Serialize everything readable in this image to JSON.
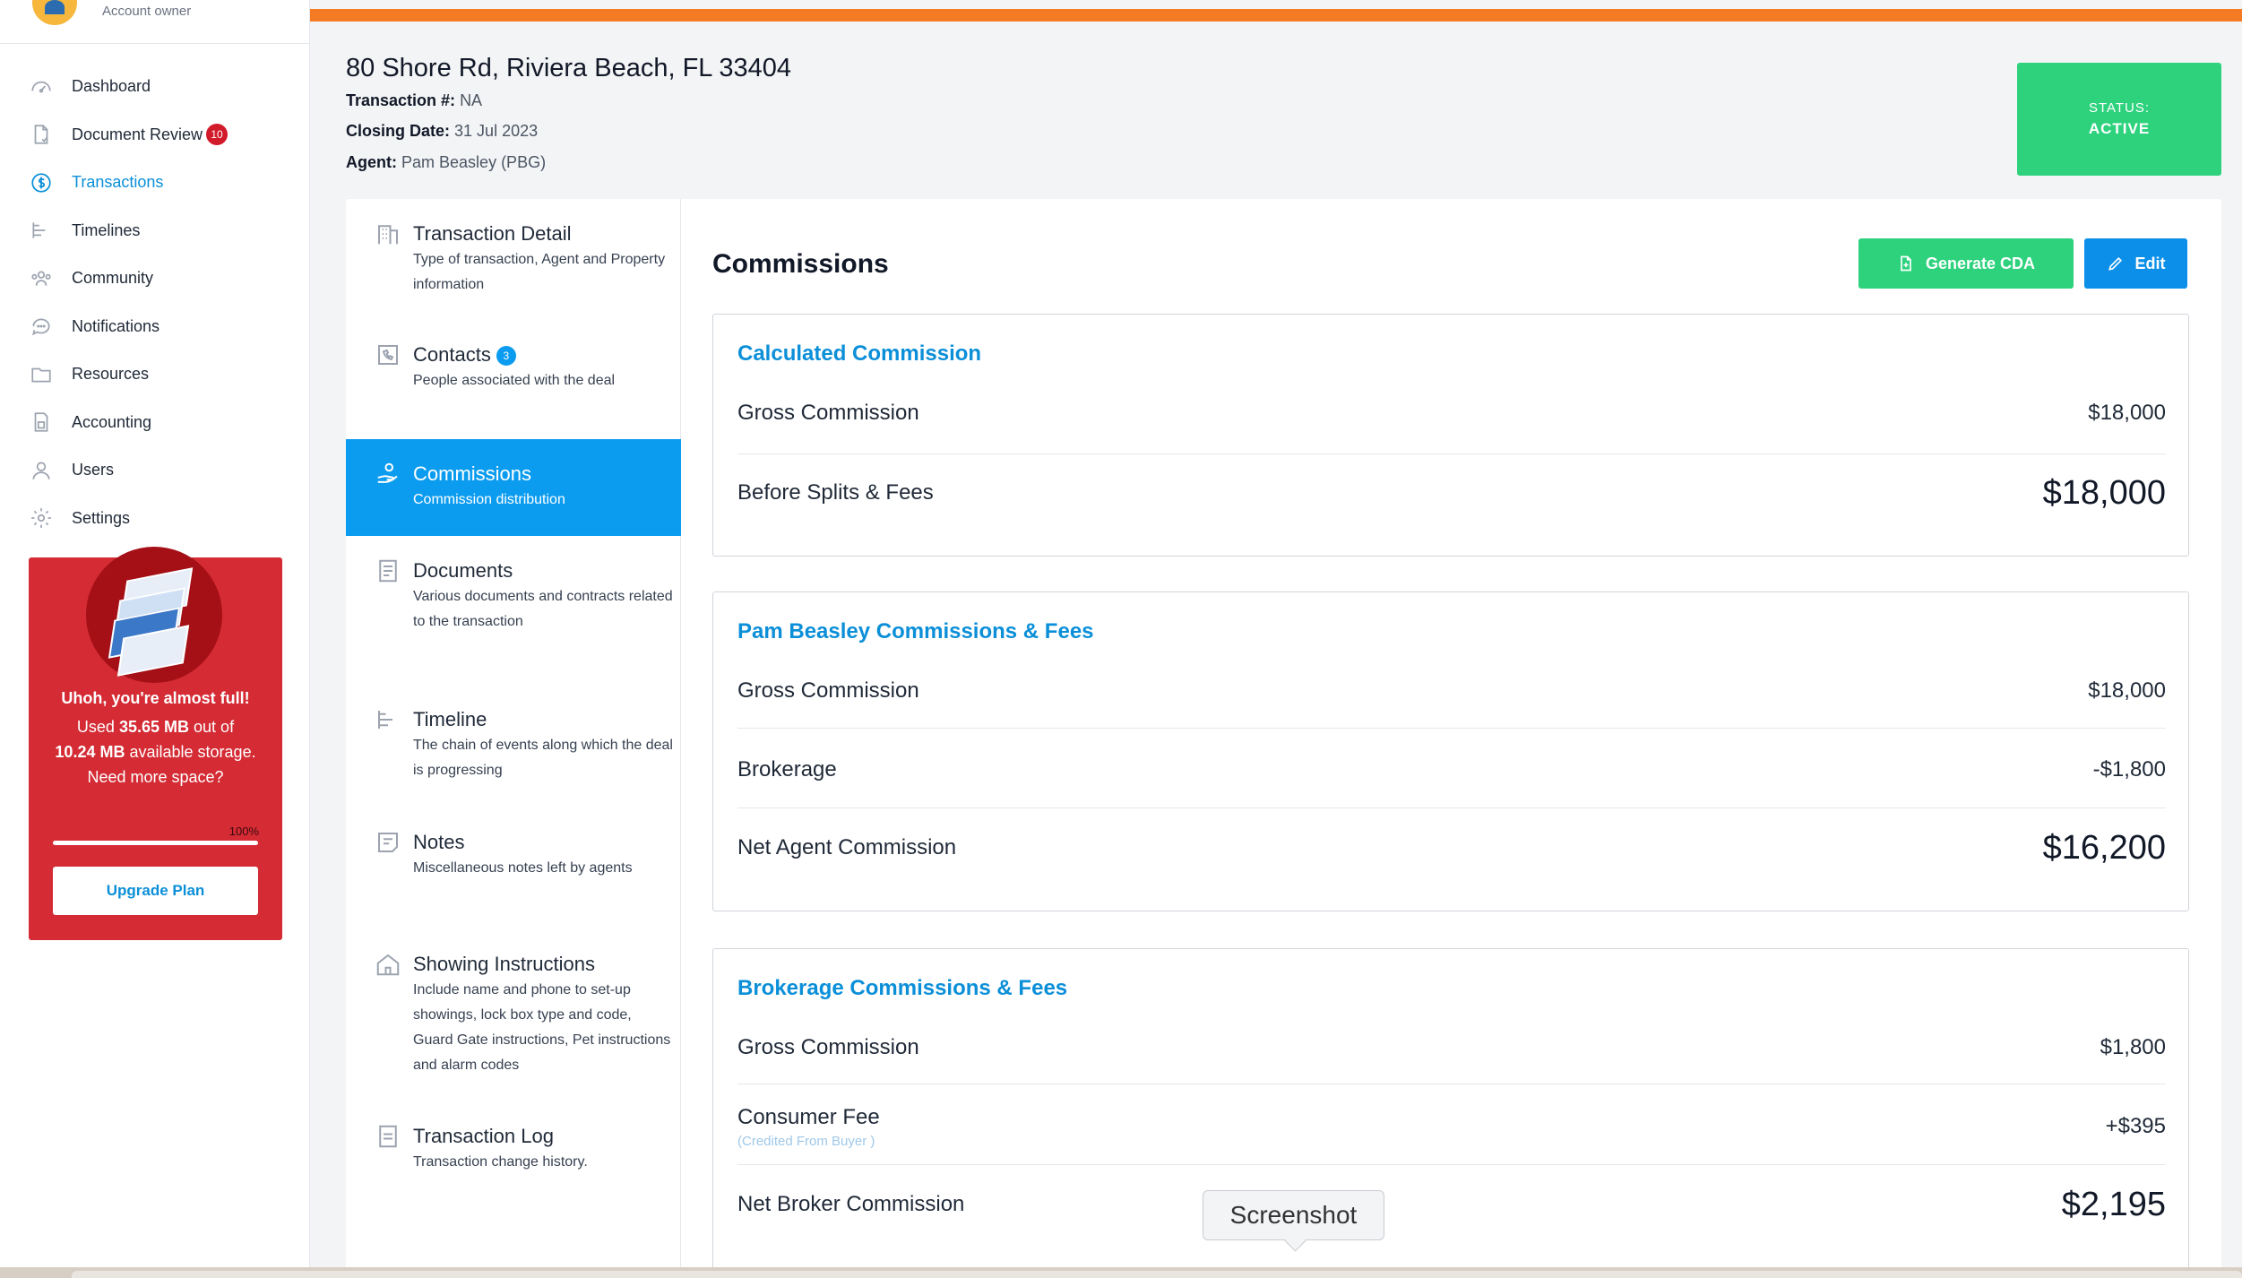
{
  "account": {
    "role": "Account owner"
  },
  "sidebar": {
    "items": [
      {
        "label": "Dashboard",
        "icon": "gauge-icon"
      },
      {
        "label": "Document Review",
        "icon": "document-check-icon",
        "badge": "10"
      },
      {
        "label": "Transactions",
        "icon": "dollar-circle-icon",
        "active": true
      },
      {
        "label": "Timelines",
        "icon": "timeline-icon"
      },
      {
        "label": "Community",
        "icon": "people-icon"
      },
      {
        "label": "Notifications",
        "icon": "chat-bubble-icon"
      },
      {
        "label": "Resources",
        "icon": "folder-icon"
      },
      {
        "label": "Accounting",
        "icon": "calculator-icon"
      },
      {
        "label": "Users",
        "icon": "user-icon"
      },
      {
        "label": "Settings",
        "icon": "gear-icon"
      }
    ],
    "storage": {
      "title": "Uhoh, you're almost full!",
      "used_prefix": "Used",
      "used": "35.65 MB",
      "out_of": "out of",
      "available": "10.24 MB",
      "available_suffix": "available storage.",
      "question": "Need more space?",
      "percent_label": "100%",
      "percent": 100,
      "button": "Upgrade Plan"
    }
  },
  "header": {
    "address": "80 Shore Rd, Riviera Beach, FL 33404",
    "transaction_label": "Transaction #:",
    "transaction_value": "NA",
    "closing_label": "Closing Date:",
    "closing_value": "31 Jul 2023",
    "agent_label": "Agent:",
    "agent_value": "Pam Beasley (PBG)",
    "status_label": "STATUS:",
    "status_value": "ACTIVE"
  },
  "tabs": [
    {
      "title": "Transaction Detail",
      "desc": "Type of transaction, Agent and Property information",
      "icon": "building-icon"
    },
    {
      "title": "Contacts",
      "badge": "3",
      "desc": "People associated with the deal",
      "icon": "phone-book-icon"
    },
    {
      "title": "Commissions",
      "desc": "Commission distribution",
      "icon": "hand-coin-icon",
      "active": true
    },
    {
      "title": "Documents",
      "desc": "Various documents and contracts related to the transaction",
      "icon": "document-list-icon"
    },
    {
      "title": "Timeline",
      "desc": "The chain of events along which the deal is progressing",
      "icon": "timeline-icon"
    },
    {
      "title": "Notes",
      "desc": "Miscellaneous notes left by agents",
      "icon": "note-icon"
    },
    {
      "title": "Showing Instructions",
      "desc": "Include name and phone to set-up showings, lock box type and code, Guard Gate instructions, Pet instructions and alarm codes",
      "icon": "house-icon"
    },
    {
      "title": "Transaction Log",
      "desc": "Transaction change history.",
      "icon": "log-icon"
    }
  ],
  "content": {
    "title": "Commissions",
    "generate_cda": "Generate CDA",
    "edit": "Edit",
    "calculated": {
      "title": "Calculated Commission",
      "gross_label": "Gross Commission",
      "gross_value": "$18,000",
      "before_label": "Before Splits & Fees",
      "before_value": "$18,000"
    },
    "agent": {
      "title": "Pam Beasley Commissions & Fees",
      "gross_label": "Gross Commission",
      "gross_value": "$18,000",
      "brokerage_label": "Brokerage",
      "brokerage_value": "-$1,800",
      "net_label": "Net Agent Commission",
      "net_value": "$16,200"
    },
    "brokerage": {
      "title": "Brokerage Commissions & Fees",
      "gross_label": "Gross Commission",
      "gross_value": "$1,800",
      "fee_label": "Consumer Fee",
      "fee_note": "(Credited From Buyer )",
      "fee_value": "+$395",
      "net_label": "Net Broker Commission",
      "net_value": "$2,195"
    }
  },
  "tooltip": "Screenshot",
  "colors": {
    "accent": "#0b8fd8",
    "orange": "#f47b24",
    "status": "#2ed27d",
    "alert": "#d42b34"
  }
}
